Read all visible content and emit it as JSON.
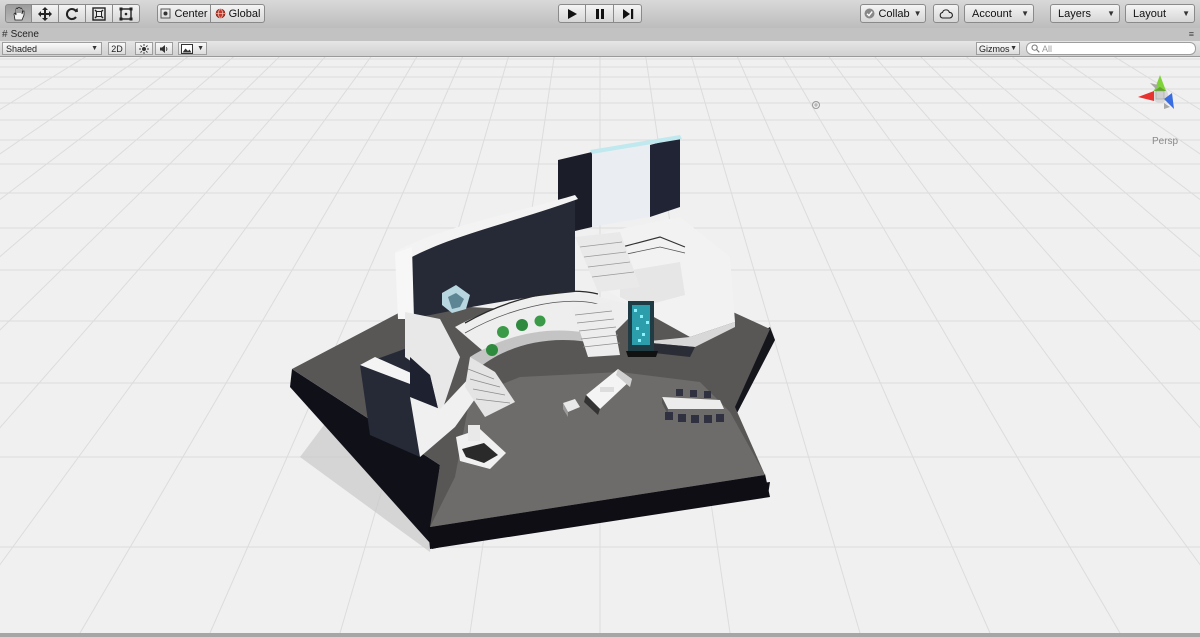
{
  "toolbar": {
    "tools": [
      {
        "name": "hand-tool",
        "icon": "hand-icon",
        "active": true
      },
      {
        "name": "move-tool",
        "icon": "move-arrows-icon",
        "active": false
      },
      {
        "name": "rotate-tool",
        "icon": "rotate-icon",
        "active": false
      },
      {
        "name": "scale-tool",
        "icon": "scale-icon",
        "active": false
      },
      {
        "name": "rect-tool",
        "icon": "rect-icon",
        "active": false
      }
    ],
    "pivot_mode": "Center",
    "pivot_rotation": "Global",
    "play_controls": [
      "play-icon",
      "pause-icon",
      "step-icon"
    ],
    "collab_label": "Collab",
    "cloud_icon": "cloud-icon",
    "account_label": "Account",
    "layers_label": "Layers",
    "layout_label": "Layout"
  },
  "tab": {
    "title": "Scene"
  },
  "scene_toolbar": {
    "shading_mode": "Shaded",
    "mode_2d": "2D",
    "gizmos_label": "Gizmos",
    "search_placeholder": "All",
    "icons": [
      "sun-icon",
      "audio-icon",
      "image-effects-icon"
    ]
  },
  "viewport": {
    "projection_label": "Persp",
    "background_color": "#f0f0f0",
    "grid_color": "#dcdcdc",
    "axis_colors": {
      "x": "#e8322f",
      "y": "#7fd23a",
      "z": "#3a6de0"
    }
  }
}
